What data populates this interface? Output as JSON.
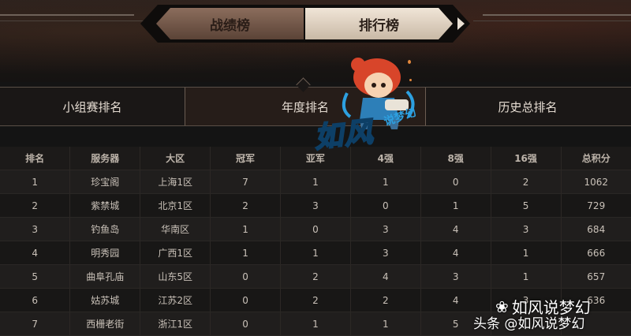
{
  "main_tabs": [
    {
      "label": "战绩榜",
      "selected": false
    },
    {
      "label": "排行榜",
      "selected": true
    }
  ],
  "sub_tabs": [
    {
      "label": "小组赛排名",
      "selected": false
    },
    {
      "label": "年度排名",
      "selected": true
    },
    {
      "label": "历史总排名",
      "selected": false
    }
  ],
  "table": {
    "headers": [
      "排名",
      "服务器",
      "大区",
      "冠军",
      "亚军",
      "4强",
      "8强",
      "16强",
      "总积分"
    ],
    "rows": [
      [
        "1",
        "珍宝阁",
        "上海1区",
        "7",
        "1",
        "1",
        "0",
        "2",
        "1062"
      ],
      [
        "2",
        "紫禁城",
        "北京1区",
        "2",
        "3",
        "0",
        "1",
        "5",
        "729"
      ],
      [
        "3",
        "钓鱼岛",
        "华南区",
        "1",
        "0",
        "3",
        "4",
        "3",
        "684"
      ],
      [
        "4",
        "明秀园",
        "广西1区",
        "1",
        "1",
        "3",
        "4",
        "1",
        "666"
      ],
      [
        "5",
        "曲阜孔庙",
        "山东5区",
        "0",
        "2",
        "4",
        "3",
        "1",
        "657"
      ],
      [
        "6",
        "姑苏城",
        "江苏2区",
        "0",
        "2",
        "2",
        "4",
        "3",
        "636"
      ],
      [
        "7",
        "西栅老街",
        "浙江1区",
        "0",
        "1",
        "1",
        "5",
        "",
        ""
      ]
    ]
  },
  "watermark": {
    "logo_text": "如风",
    "logo_sub": "说梦幻",
    "footer_line1": "如风说梦幻",
    "footer_line2": "头条 @如风说梦幻"
  },
  "colors": {
    "active_main_tab": "#e9dccb",
    "inactive_main_tab": "#6e5446",
    "background": "#141414",
    "watermark_blue": "#2da0e0"
  }
}
